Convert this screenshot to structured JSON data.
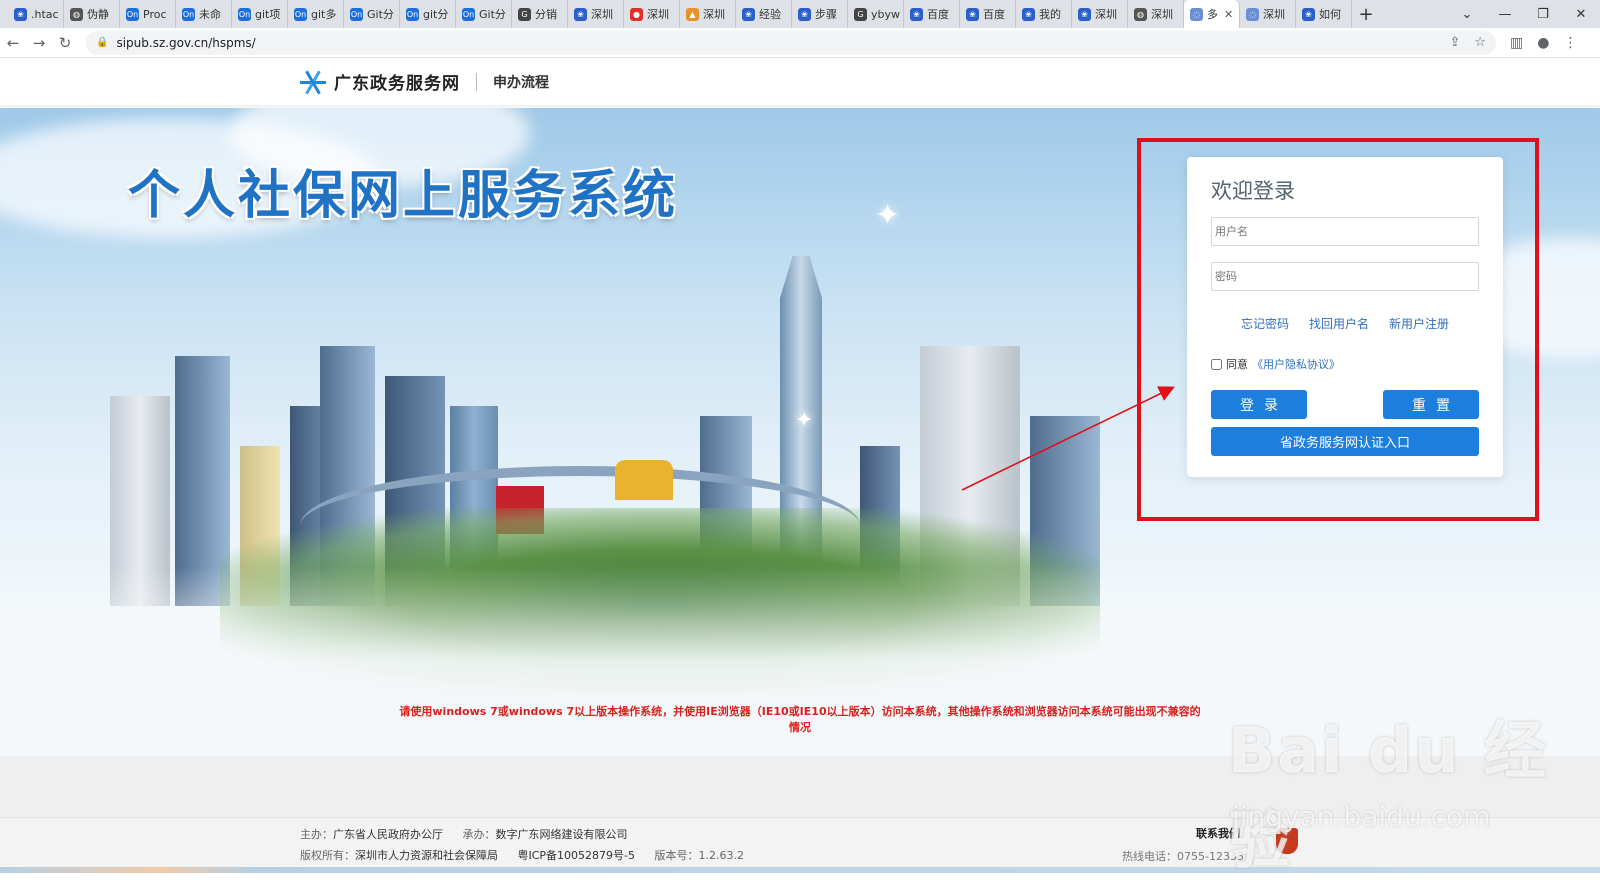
{
  "browser": {
    "tabs": [
      {
        "label": ".htac",
        "icon": "paw"
      },
      {
        "label": "伪静",
        "icon": "globe"
      },
      {
        "label": "Proc",
        "icon": "On"
      },
      {
        "label": "未命",
        "icon": "On"
      },
      {
        "label": "git项",
        "icon": "On"
      },
      {
        "label": "git多",
        "icon": "On"
      },
      {
        "label": "Git分",
        "icon": "On"
      },
      {
        "label": "git分",
        "icon": "On"
      },
      {
        "label": "Git分",
        "icon": "On"
      },
      {
        "label": "分销",
        "icon": "G"
      },
      {
        "label": "深圳",
        "icon": "paw"
      },
      {
        "label": "深圳",
        "icon": "red"
      },
      {
        "label": "深圳",
        "icon": "orange"
      },
      {
        "label": "经验",
        "icon": "paw"
      },
      {
        "label": "步骤",
        "icon": "paw"
      },
      {
        "label": "ybyw",
        "icon": "G"
      },
      {
        "label": "百度",
        "icon": "paw"
      },
      {
        "label": "百度",
        "icon": "paw"
      },
      {
        "label": "我的",
        "icon": "paw"
      },
      {
        "label": "深圳",
        "icon": "paw"
      },
      {
        "label": "深圳",
        "icon": "globe"
      },
      {
        "label": "多",
        "icon": "loading",
        "active": true
      },
      {
        "label": "深圳",
        "icon": "loading"
      },
      {
        "label": "如何",
        "icon": "paw"
      }
    ],
    "url": "sipub.sz.gov.cn/hspms/"
  },
  "site": {
    "name": "广东政务服务网",
    "nav_process": "申办流程"
  },
  "hero": {
    "title": "个人社保网上服务系统",
    "notice": "请使用windows 7或windows 7以上版本操作系统，并使用IE浏览器（IE10或IE10以上版本）访问本系统，其他操作系统和浏览器访问本系统可能出现不兼容的情况"
  },
  "login": {
    "title": "欢迎登录",
    "username_placeholder": "用户名",
    "password_placeholder": "密码",
    "forgot_password": "忘记密码",
    "recover_username": "找回用户名",
    "register": "新用户注册",
    "agree_prefix": "同意",
    "privacy_link": "《用户隐私协议》",
    "login_button": "登录",
    "reset_button": "重置",
    "gov_auth_button": "省政务服务网认证入口"
  },
  "footer": {
    "sponsor_label": "主办：",
    "sponsor": "广东省人民政府办公厅",
    "contractor_label": "承办：",
    "contractor": "数字广东网络建设有限公司",
    "copyright_label": "版权所有：",
    "copyright": "深圳市人力资源和社会保障局",
    "icp": "粤ICP备10052879号-5",
    "version_label": "版本号：",
    "version": "1.2.63.2",
    "contact": "联系我们",
    "hotline_label": "热线电话：",
    "hotline": "0755-12333"
  },
  "watermark": {
    "brand": "Bai du 经验",
    "url": "jingyan.baidu.com"
  },
  "colors": {
    "accent": "#1c7fde",
    "title_blue": "#1f72c4",
    "notice_red": "#d9201e",
    "annotation_red": "#e0101a"
  }
}
